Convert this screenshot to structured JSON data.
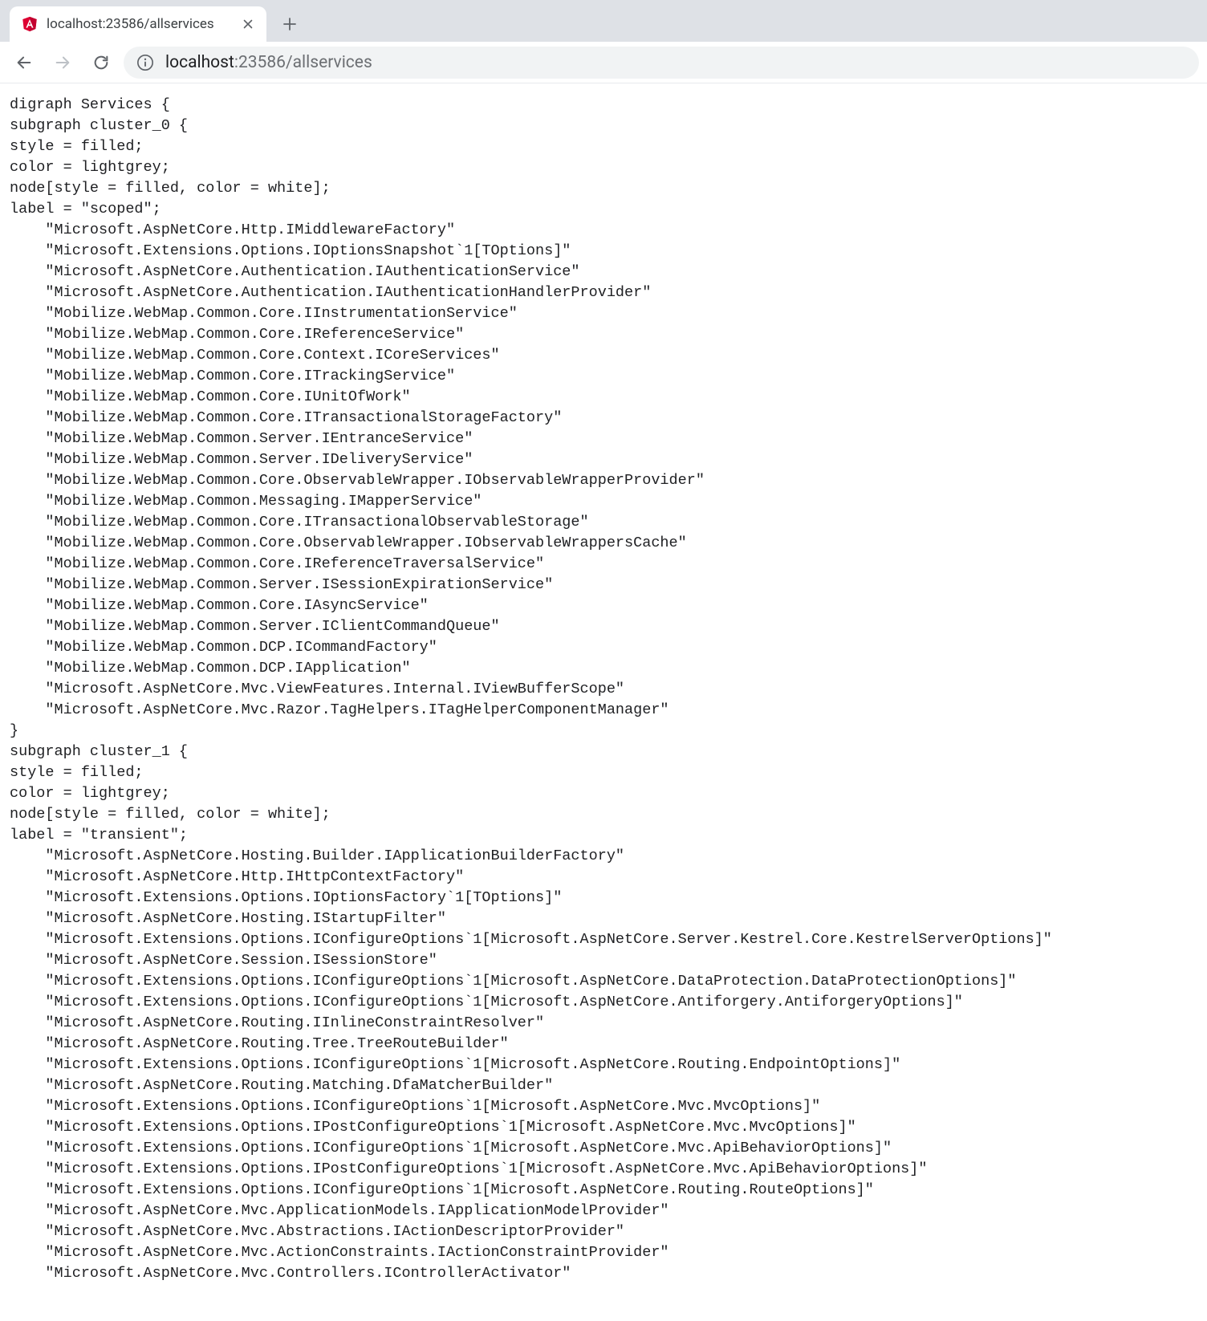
{
  "tab": {
    "title": "localhost:23586/allservices"
  },
  "url": {
    "host": "localhost",
    "port_path": ":23586/allservices"
  },
  "dot": {
    "open": "digraph Services {",
    "cluster0": {
      "open": "subgraph cluster_0 {",
      "style": "style = filled;",
      "color": "color = lightgrey;",
      "node": "node[style = filled, color = white];",
      "label": "label = \"scoped\";",
      "items": [
        "\"Microsoft.AspNetCore.Http.IMiddlewareFactory\"",
        "\"Microsoft.Extensions.Options.IOptionsSnapshot`1[TOptions]\"",
        "\"Microsoft.AspNetCore.Authentication.IAuthenticationService\"",
        "\"Microsoft.AspNetCore.Authentication.IAuthenticationHandlerProvider\"",
        "\"Mobilize.WebMap.Common.Core.IInstrumentationService\"",
        "\"Mobilize.WebMap.Common.Core.IReferenceService\"",
        "\"Mobilize.WebMap.Common.Core.Context.ICoreServices\"",
        "\"Mobilize.WebMap.Common.Core.ITrackingService\"",
        "\"Mobilize.WebMap.Common.Core.IUnitOfWork\"",
        "\"Mobilize.WebMap.Common.Core.ITransactionalStorageFactory\"",
        "\"Mobilize.WebMap.Common.Server.IEntranceService\"",
        "\"Mobilize.WebMap.Common.Server.IDeliveryService\"",
        "\"Mobilize.WebMap.Common.Core.ObservableWrapper.IObservableWrapperProvider\"",
        "\"Mobilize.WebMap.Common.Messaging.IMapperService\"",
        "\"Mobilize.WebMap.Common.Core.ITransactionalObservableStorage\"",
        "\"Mobilize.WebMap.Common.Core.ObservableWrapper.IObservableWrappersCache\"",
        "\"Mobilize.WebMap.Common.Core.IReferenceTraversalService\"",
        "\"Mobilize.WebMap.Common.Server.ISessionExpirationService\"",
        "\"Mobilize.WebMap.Common.Core.IAsyncService\"",
        "\"Mobilize.WebMap.Common.Server.IClientCommandQueue\"",
        "\"Mobilize.WebMap.Common.DCP.ICommandFactory\"",
        "\"Mobilize.WebMap.Common.DCP.IApplication\"",
        "\"Microsoft.AspNetCore.Mvc.ViewFeatures.Internal.IViewBufferScope\"",
        "\"Microsoft.AspNetCore.Mvc.Razor.TagHelpers.ITagHelperComponentManager\""
      ],
      "close": "}"
    },
    "cluster1": {
      "open": "subgraph cluster_1 {",
      "style": "style = filled;",
      "color": "color = lightgrey;",
      "node": "node[style = filled, color = white];",
      "label": "label = \"transient\";",
      "items": [
        "\"Microsoft.AspNetCore.Hosting.Builder.IApplicationBuilderFactory\"",
        "\"Microsoft.AspNetCore.Http.IHttpContextFactory\"",
        "\"Microsoft.Extensions.Options.IOptionsFactory`1[TOptions]\"",
        "\"Microsoft.AspNetCore.Hosting.IStartupFilter\"",
        "\"Microsoft.Extensions.Options.IConfigureOptions`1[Microsoft.AspNetCore.Server.Kestrel.Core.KestrelServerOptions]\"",
        "\"Microsoft.AspNetCore.Session.ISessionStore\"",
        "\"Microsoft.Extensions.Options.IConfigureOptions`1[Microsoft.AspNetCore.DataProtection.DataProtectionOptions]\"",
        "\"Microsoft.Extensions.Options.IConfigureOptions`1[Microsoft.AspNetCore.Antiforgery.AntiforgeryOptions]\"",
        "\"Microsoft.AspNetCore.Routing.IInlineConstraintResolver\"",
        "\"Microsoft.AspNetCore.Routing.Tree.TreeRouteBuilder\"",
        "\"Microsoft.Extensions.Options.IConfigureOptions`1[Microsoft.AspNetCore.Routing.EndpointOptions]\"",
        "\"Microsoft.AspNetCore.Routing.Matching.DfaMatcherBuilder\"",
        "\"Microsoft.Extensions.Options.IConfigureOptions`1[Microsoft.AspNetCore.Mvc.MvcOptions]\"",
        "\"Microsoft.Extensions.Options.IPostConfigureOptions`1[Microsoft.AspNetCore.Mvc.MvcOptions]\"",
        "\"Microsoft.Extensions.Options.IConfigureOptions`1[Microsoft.AspNetCore.Mvc.ApiBehaviorOptions]\"",
        "\"Microsoft.Extensions.Options.IPostConfigureOptions`1[Microsoft.AspNetCore.Mvc.ApiBehaviorOptions]\"",
        "\"Microsoft.Extensions.Options.IConfigureOptions`1[Microsoft.AspNetCore.Routing.RouteOptions]\"",
        "\"Microsoft.AspNetCore.Mvc.ApplicationModels.IApplicationModelProvider\"",
        "\"Microsoft.AspNetCore.Mvc.Abstractions.IActionDescriptorProvider\"",
        "\"Microsoft.AspNetCore.Mvc.ActionConstraints.IActionConstraintProvider\"",
        "\"Microsoft.AspNetCore.Mvc.Controllers.IControllerActivator\""
      ]
    }
  },
  "indent": "    "
}
